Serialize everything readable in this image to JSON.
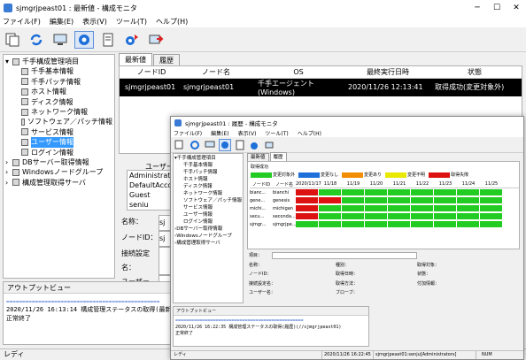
{
  "main": {
    "title": "sjmgrjpeast01 : 最新値 - 構成モニタ",
    "menu": [
      "ファイル(F)",
      "編集(E)",
      "表示(V)",
      "ツール(T)",
      "ヘルプ(H)"
    ],
    "tree": {
      "root": "千手構成管理項目",
      "items": [
        "千手基本情報",
        "千手パッチ情報",
        "ホスト情報",
        "ディスク情報",
        "ネットワーク情報",
        "ソフトウェア／パッチ情報",
        "サービス情報",
        "ユーザー情報",
        "ログイン情報"
      ],
      "groups": [
        "DBサーバー取得情報",
        "Windowsノードグループ",
        "構成管理取得サーバ"
      ]
    },
    "tabs": [
      "最新値",
      "履歴"
    ],
    "table": {
      "headers": [
        "ノードID",
        "ノード名",
        "OS",
        "最終実行日時",
        "状態"
      ],
      "row": [
        "sjmgrjpeast01",
        "sjmgrjpeast01",
        "千手エージェント(Windows)",
        "2020/11/26 12:13:41",
        "取得成功(変更対象外)"
      ]
    },
    "user_panel": {
      "header": "ユーザー名",
      "users": [
        "Administrator",
        "DefaultAccou",
        "Guest",
        "seniu"
      ]
    },
    "fields": [
      "名称：",
      "ノードID：",
      "接続設定名：",
      "ユーザー名："
    ],
    "field_values": [
      "sj",
      "sj",
      "",
      ""
    ],
    "output": {
      "title": "アウトプットビュー",
      "separator": "================================================",
      "line1": "2020/11/26 16:13:14 構成管理ステータスの取得(最新値",
      "line2": "正常終了"
    },
    "status": "レディ"
  },
  "history": {
    "title": "sjmgrjpeast01 : 履歴 - 構成モニタ",
    "menu": [
      "ファイル(F)",
      "編集(E)",
      "表示(V)",
      "ツール(T)",
      "ヘルプ(H)"
    ],
    "tree": {
      "root": "千手構成管理項目",
      "items": [
        "千手基本情報",
        "千手パッチ情報",
        "ホスト情報",
        "ディスク情報",
        "ネットワーク情報",
        "ソフトウェア／パッチ情報",
        "サービス情報",
        "ユーザー情報",
        "ログイン情報"
      ],
      "groups": [
        "DBサーバー取得情報",
        "Windowsノードグループ",
        "構成管理取得サーバ"
      ]
    },
    "tabs": [
      "最新値",
      "履歴"
    ],
    "legend_title": "取得成功",
    "legend": [
      {
        "label": "変更対象外",
        "color": "#22cc22"
      },
      {
        "label": "変更なし",
        "color": "#1e6fd9"
      },
      {
        "label": "変更あり",
        "color": "#f28c00"
      },
      {
        "label": "変更不明",
        "color": "#e8e800"
      },
      {
        "label": "取得失敗",
        "color": "#dd1111"
      }
    ],
    "grid_headers": [
      "ノードID",
      "ノード名",
      "2020/11/17",
      "11/18",
      "11/19",
      "11/20",
      "11/21",
      "11/22",
      "11/23",
      "11/24",
      "11/25"
    ],
    "grid_rows": [
      {
        "id": "bianc...",
        "name": "bianchi",
        "cells": [
          "r",
          "g",
          "g",
          "g",
          "g",
          "g",
          "g",
          "g",
          "g"
        ]
      },
      {
        "id": "gene...",
        "name": "genesis",
        "cells": [
          "r",
          "r",
          "g",
          "g",
          "g",
          "g",
          "g",
          "g",
          "g"
        ]
      },
      {
        "id": "michi...",
        "name": "michigan",
        "cells": [
          "r",
          "g",
          "g",
          "g",
          "g",
          "g",
          "g",
          "g",
          "g"
        ]
      },
      {
        "id": "secu...",
        "name": "seconda...",
        "cells": [
          "r",
          "g",
          "g",
          "g",
          "g",
          "g",
          "g",
          "g",
          "g"
        ]
      },
      {
        "id": "sjmgr...",
        "name": "sjmgrjpe...",
        "cells": [
          "g",
          "g",
          "g",
          "g",
          "g",
          "g",
          "g",
          "g",
          "g"
        ]
      }
    ],
    "fields_left": [
      "項目：",
      "名称：",
      "ノードID：",
      "接続設定名：",
      "ユーザー名："
    ],
    "fields_mid": [
      "種別：",
      "取得日時：",
      "取得方法：",
      "ブローブ："
    ],
    "fields_right": [
      "取得対象：",
      "状態：",
      "付加情報："
    ],
    "output": {
      "title": "アウトプットビュー",
      "separator": "================================================",
      "line1": "2020/11/26 16:22:35 構成管理ステータスの取得(履歴)(//sjmgrjpeast01)",
      "line2": "正常終了"
    },
    "status": [
      "レディ",
      "2020/11/26 16:22:45",
      "sjmgrjpeast01:senju[Administrators]",
      "NUM"
    ]
  }
}
